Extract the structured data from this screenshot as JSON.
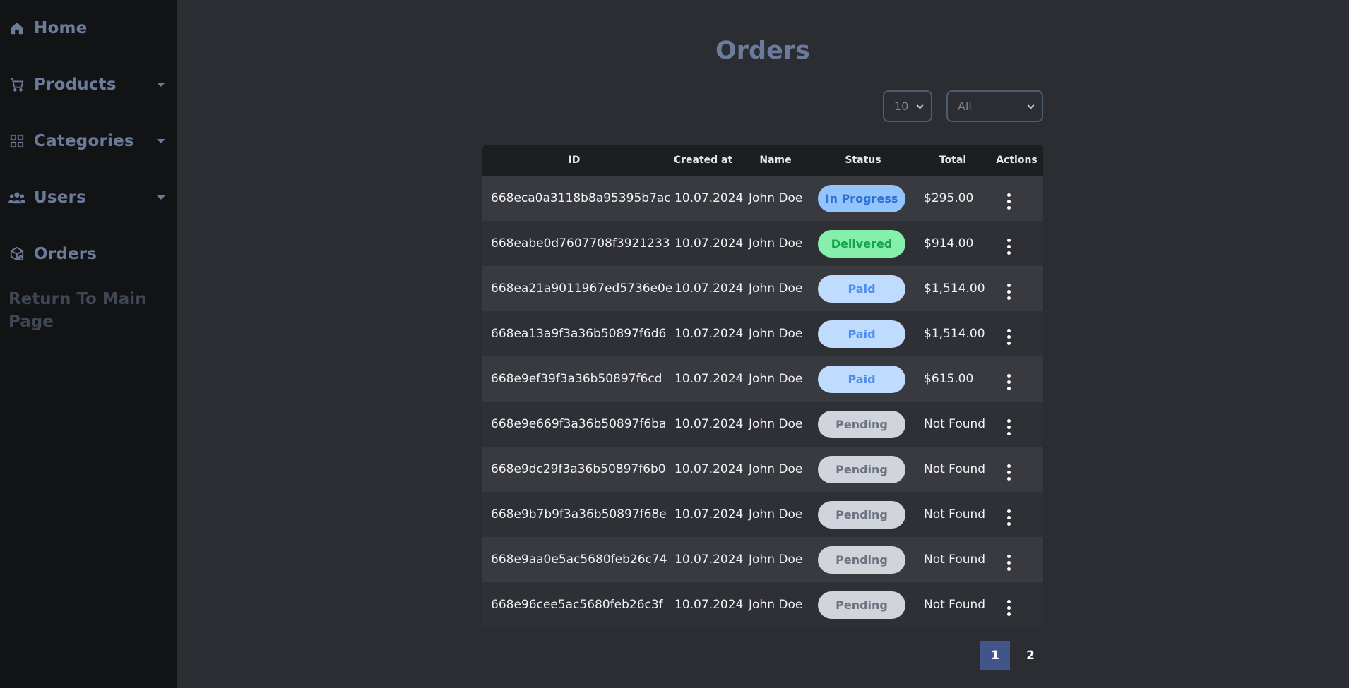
{
  "sidebar": {
    "items": [
      {
        "label": "Home",
        "icon": "home-icon",
        "has_caret": false
      },
      {
        "label": "Products",
        "icon": "cart-icon",
        "has_caret": true
      },
      {
        "label": "Categories",
        "icon": "grid-icon",
        "has_caret": true
      },
      {
        "label": "Users",
        "icon": "users-icon",
        "has_caret": true
      },
      {
        "label": "Orders",
        "icon": "package-icon",
        "has_caret": false
      }
    ],
    "return_link": "Return To Main Page"
  },
  "page": {
    "title": "Orders"
  },
  "filters": {
    "page_size": {
      "value": "10"
    },
    "status": {
      "value": "All"
    }
  },
  "table": {
    "columns": [
      "ID",
      "Created at",
      "Name",
      "Status",
      "Total",
      "Actions"
    ],
    "rows": [
      {
        "id": "668eca0a3118b8a95395b7ac",
        "created": "10.07.2024",
        "name": "John Doe",
        "status": "In Progress",
        "total": "$295.00"
      },
      {
        "id": "668eabe0d7607708f3921233",
        "created": "10.07.2024",
        "name": "John Doe",
        "status": "Delivered",
        "total": "$914.00"
      },
      {
        "id": "668ea21a9011967ed5736e0e",
        "created": "10.07.2024",
        "name": "John Doe",
        "status": "Paid",
        "total": "$1,514.00"
      },
      {
        "id": "668ea13a9f3a36b50897f6d6",
        "created": "10.07.2024",
        "name": "John Doe",
        "status": "Paid",
        "total": "$1,514.00"
      },
      {
        "id": "668e9ef39f3a36b50897f6cd",
        "created": "10.07.2024",
        "name": "John Doe",
        "status": "Paid",
        "total": "$615.00"
      },
      {
        "id": "668e9e669f3a36b50897f6ba",
        "created": "10.07.2024",
        "name": "John Doe",
        "status": "Pending",
        "total": "Not Found"
      },
      {
        "id": "668e9dc29f3a36b50897f6b0",
        "created": "10.07.2024",
        "name": "John Doe",
        "status": "Pending",
        "total": "Not Found"
      },
      {
        "id": "668e9b7b9f3a36b50897f68e",
        "created": "10.07.2024",
        "name": "John Doe",
        "status": "Pending",
        "total": "Not Found"
      },
      {
        "id": "668e9aa0e5ac5680feb26c74",
        "created": "10.07.2024",
        "name": "John Doe",
        "status": "Pending",
        "total": "Not Found"
      },
      {
        "id": "668e96cee5ac5680feb26c3f",
        "created": "10.07.2024",
        "name": "John Doe",
        "status": "Pending",
        "total": "Not Found"
      }
    ]
  },
  "status_colors": {
    "In Progress": {
      "bg": "#93c5fd",
      "fg": "#2f6fd6"
    },
    "Delivered": {
      "bg": "#86efac",
      "fg": "#16a34a"
    },
    "Paid": {
      "bg": "#bfdbfe",
      "fg": "#4d8ff0"
    },
    "Pending": {
      "bg": "#d1d5db",
      "fg": "#6b7280"
    }
  },
  "pagination": {
    "pages": [
      "1",
      "2"
    ],
    "current": "1"
  },
  "colors": {
    "accent": "#40568a",
    "sidebar_text": "#6b7b99"
  }
}
